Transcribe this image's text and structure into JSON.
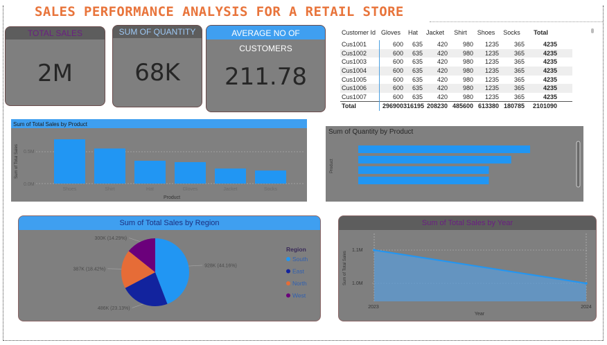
{
  "title": "SALES PERFORMANCE ANALYSIS FOR A RETAIL STORE",
  "kpis": {
    "total_sales": {
      "label": "TOTAL SALES",
      "value": "2M"
    },
    "sum_quantity": {
      "label": "SUM OF QUANTITY",
      "value": "68K"
    },
    "avg_customers": {
      "label": "AVERAGE NO OF CUSTOMERS",
      "value": "211.78"
    }
  },
  "table": {
    "columns": [
      "Customer Id",
      "Gloves",
      "Hat",
      "Jacket",
      "Shirt",
      "Shoes",
      "Socks",
      "Total"
    ],
    "rows": [
      [
        "Cus1001",
        "600",
        "635",
        "420",
        "980",
        "1235",
        "365",
        "4235"
      ],
      [
        "Cus1002",
        "600",
        "635",
        "420",
        "980",
        "1235",
        "365",
        "4235"
      ],
      [
        "Cus1003",
        "600",
        "635",
        "420",
        "980",
        "1235",
        "365",
        "4235"
      ],
      [
        "Cus1004",
        "600",
        "635",
        "420",
        "980",
        "1235",
        "365",
        "4235"
      ],
      [
        "Cus1005",
        "600",
        "635",
        "420",
        "980",
        "1235",
        "365",
        "4235"
      ],
      [
        "Cus1006",
        "600",
        "635",
        "420",
        "980",
        "1235",
        "365",
        "4235"
      ],
      [
        "Cus1007",
        "600",
        "635",
        "420",
        "980",
        "1235",
        "365",
        "4235"
      ]
    ],
    "total": [
      "Total",
      "296900",
      "316195",
      "208230",
      "485600",
      "613380",
      "180785",
      "2101090"
    ]
  },
  "chart_data": [
    {
      "type": "bar",
      "title": "Sum of Total Sales by Product",
      "categories": [
        "Shoes",
        "Shirt",
        "Hat",
        "Gloves",
        "Jacket",
        "Socks"
      ],
      "values": [
        613380,
        485600,
        316195,
        296900,
        208230,
        180785
      ],
      "xlabel": "Product",
      "ylabel": "Sum of Total Sales",
      "yticks": [
        "0.0M",
        "0.5M"
      ],
      "ylim": [
        0,
        700000
      ],
      "grid": true,
      "color": "#2196f3"
    },
    {
      "type": "bar",
      "orientation": "horizontal",
      "title": "Sum of Quantity by Product",
      "ylabel": "Product",
      "values": [
        20000,
        17800,
        15200,
        15200
      ],
      "xlim": [
        0,
        25000
      ],
      "color": "#2196f3"
    },
    {
      "type": "pie",
      "title": "Sum of Total Sales by Region",
      "legend_title": "Region",
      "legend_position": "right",
      "labels": [
        "South",
        "East",
        "North",
        "West"
      ],
      "values": [
        928000,
        486000,
        387000,
        300000
      ],
      "data_labels": [
        "928K (44.16%)",
        "486K (23.13%)",
        "387K (18.42%)",
        "300K (14.29%)"
      ],
      "colors": [
        "#2196f3",
        "#12239e",
        "#e66c37",
        "#6b007b"
      ]
    },
    {
      "type": "area",
      "title": "Sum of Total Sales by Year",
      "x": [
        "2023",
        "2024"
      ],
      "values": [
        1100000,
        990000
      ],
      "xlabel": "Year",
      "ylabel": "Sum of Total Sales",
      "yticks": [
        "1.0M",
        "1.1M"
      ],
      "ylim": [
        975000,
        1110000
      ],
      "color": "#2196f3"
    }
  ]
}
